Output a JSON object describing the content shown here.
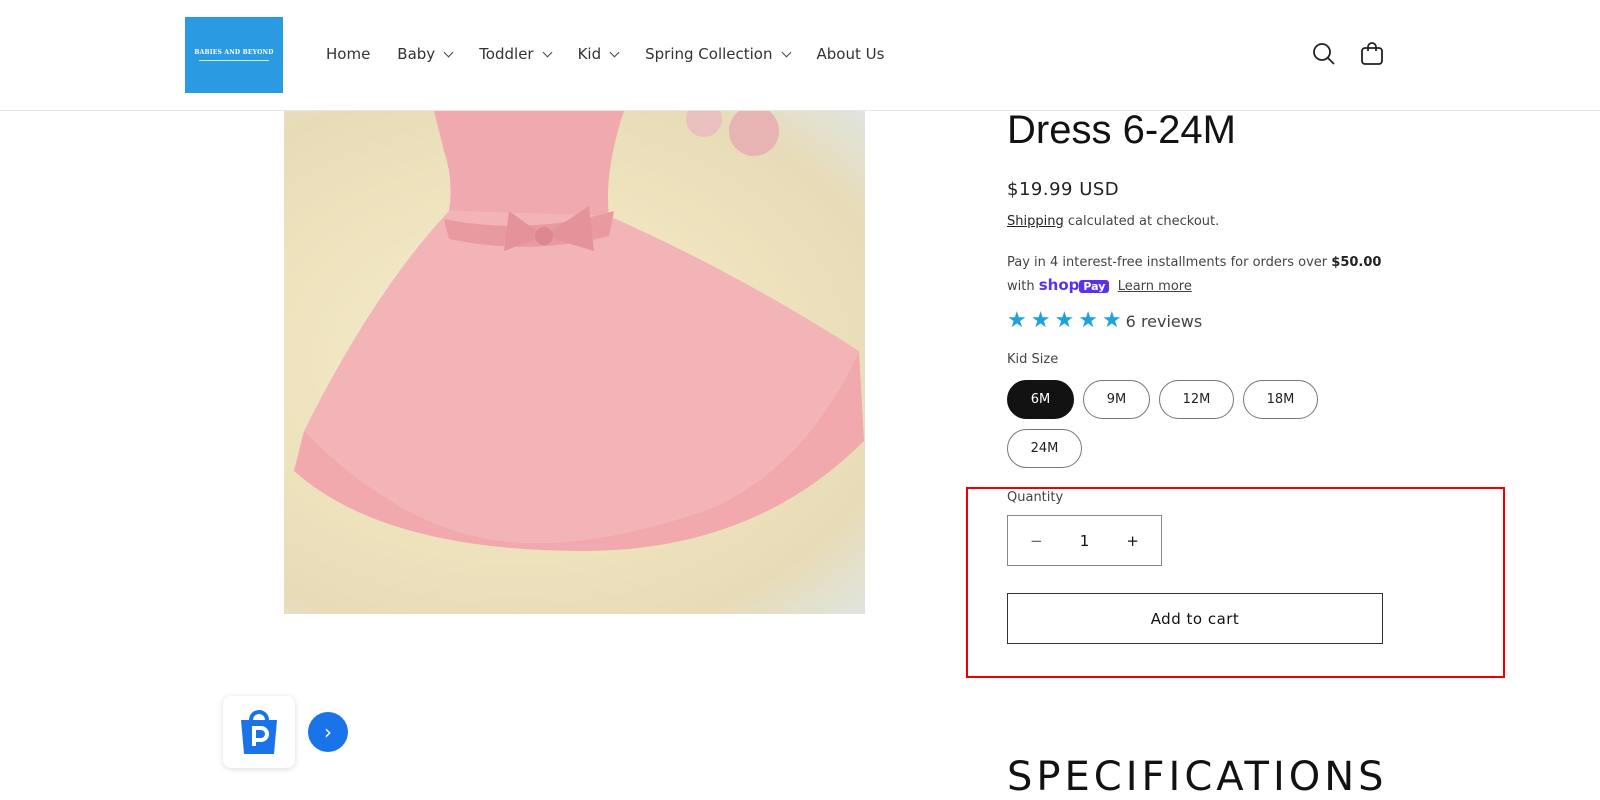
{
  "header": {
    "logo_text": "BABIES AND BEYOND",
    "nav": [
      {
        "label": "Home"
      },
      {
        "label": "Baby"
      },
      {
        "label": "Toddler"
      },
      {
        "label": "Kid"
      },
      {
        "label": "Spring Collection"
      },
      {
        "label": "About Us"
      }
    ]
  },
  "product": {
    "title": "Dress 6-24M",
    "price": "$19.99 USD",
    "shipping_link": "Shipping",
    "shipping_text": " calculated at checkout.",
    "installments_text": "Pay in 4 interest-free installments for orders over ",
    "installments_amount": "$50.00",
    "with": "with",
    "shop_text": "shop",
    "pay_text": "Pay",
    "learn_more": "Learn more",
    "rating": 5,
    "reviews": "6 reviews",
    "size_label": "Kid Size",
    "sizes": [
      "6M",
      "9M",
      "12M",
      "18M",
      "24M"
    ],
    "selected_size": "6M",
    "quantity_label": "Quantity",
    "quantity": "1",
    "minus": "−",
    "plus": "+",
    "add_to_cart": "Add to cart",
    "specs_heading": "SPECIFICATIONS"
  },
  "colors": {
    "accent": "#2a9be3",
    "stars": "#1fa1e0",
    "shop_pay": "#5a31f4",
    "highlight": "#e00000"
  }
}
